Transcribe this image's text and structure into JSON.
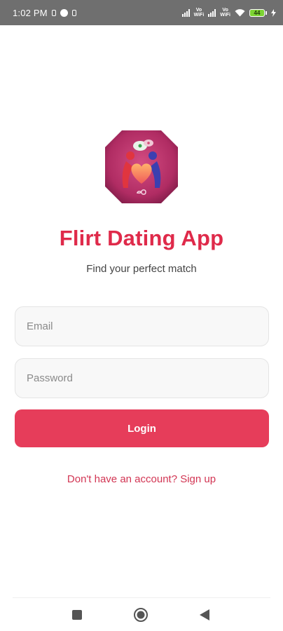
{
  "status_bar": {
    "time": "1:02 PM",
    "network_label_1": "Vo\nWiFi",
    "network_label_2": "Vo\nWiFi",
    "battery_level": "44",
    "battery_color": "#7cd332"
  },
  "app": {
    "title": "Flirt Dating App",
    "subtitle": "Find your perfect match",
    "brand_color": "#df2a4a",
    "icon_name": "couple-heart-app-icon"
  },
  "form": {
    "email_placeholder": "Email",
    "email_value": "",
    "password_placeholder": "Password",
    "password_value": "",
    "login_label": "Login",
    "login_color": "#e63d5a"
  },
  "signup": {
    "text": "Don't have an account? Sign up"
  },
  "nav": {
    "recents_icon": "square-icon",
    "home_icon": "circle-icon",
    "back_icon": "triangle-back-icon"
  }
}
